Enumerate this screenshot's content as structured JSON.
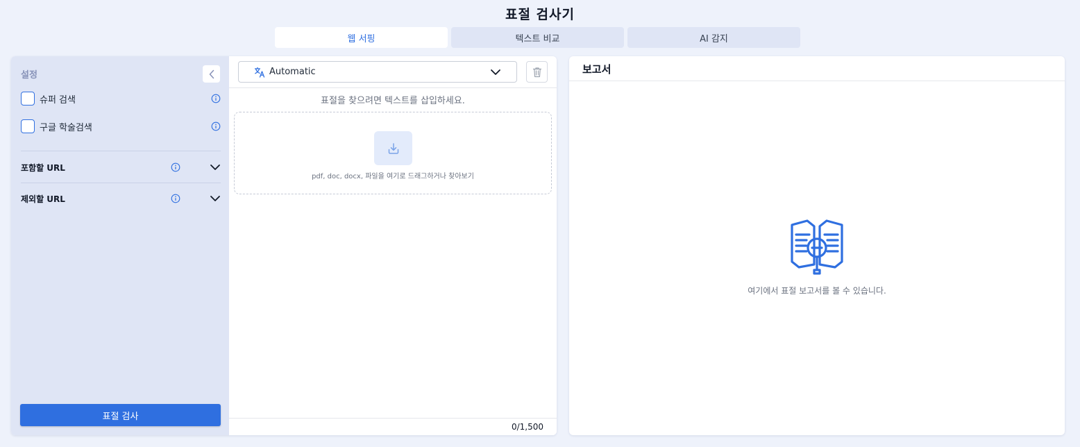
{
  "app": {
    "title": "표절 검사기"
  },
  "tabs": [
    {
      "label": "웹 서핑",
      "active": true
    },
    {
      "label": "텍스트 비교",
      "active": false
    },
    {
      "label": "AI 감지",
      "active": false
    }
  ],
  "sidebar": {
    "title": "설정",
    "options": [
      {
        "label": "슈퍼 검색",
        "checked": false
      },
      {
        "label": "구글 학술검색",
        "checked": false
      }
    ],
    "accordions": [
      {
        "label": "포함할 URL"
      },
      {
        "label": "제외할 URL"
      }
    ],
    "submit_label": "표절 검사"
  },
  "editor": {
    "language": "Automatic",
    "placeholder": "표절을 찾으려면 텍스트를 삽입하세요.",
    "dropzone_text": "pdf, doc, docx, 파일을 여기로 드래그하거나 찾아보기",
    "counter": "0/1,500"
  },
  "report": {
    "title": "보고서",
    "empty_text": "여기에서 표절 보고서를 볼 수 있습니다."
  },
  "colors": {
    "accent": "#2f6fe0",
    "sidebar_bg": "#dfe5f5",
    "page_bg": "#eef2fb"
  },
  "icons": [
    "chevron-left-icon",
    "info-icon",
    "chevron-down-icon",
    "translate-icon",
    "trash-icon",
    "download-icon",
    "book-magnifier-icon"
  ]
}
